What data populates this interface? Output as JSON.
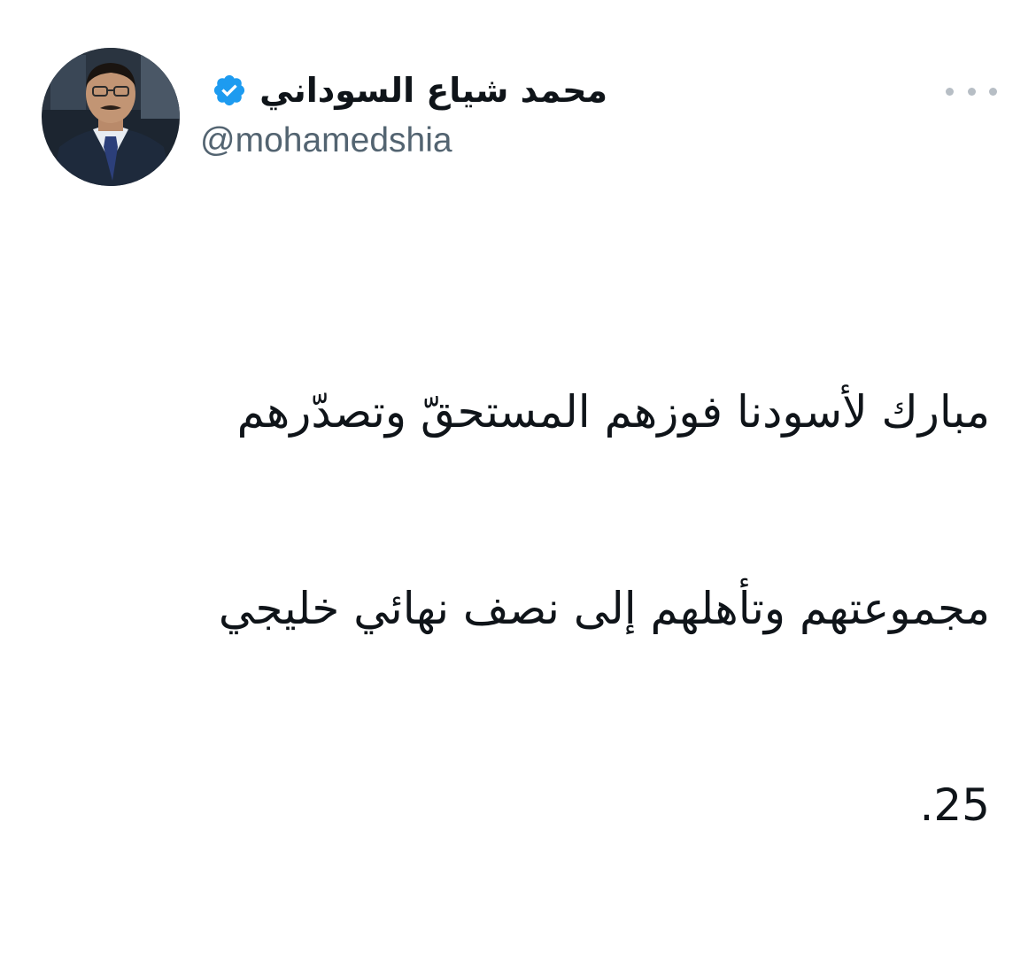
{
  "author": {
    "display_name": "محمد شياع السوداني",
    "handle": "@mohamedshia",
    "verified": true,
    "verified_icon": "verified-badge-icon",
    "avatar_icon": "profile-photo"
  },
  "tweet": {
    "lines": [
      "مبارك لأسودنا  فوزهم المستحقّ وتصدّرهم",
      "مجموعتهم وتأهلهم إلى نصف نهائي خليجي",
      "25."
    ]
  },
  "menu": {
    "icon": "more-options-icon"
  },
  "colors": {
    "text_primary": "#0f1419",
    "text_secondary": "#536471",
    "verified_blue": "#1d9bf0",
    "more_dots": "#b7bec5"
  }
}
